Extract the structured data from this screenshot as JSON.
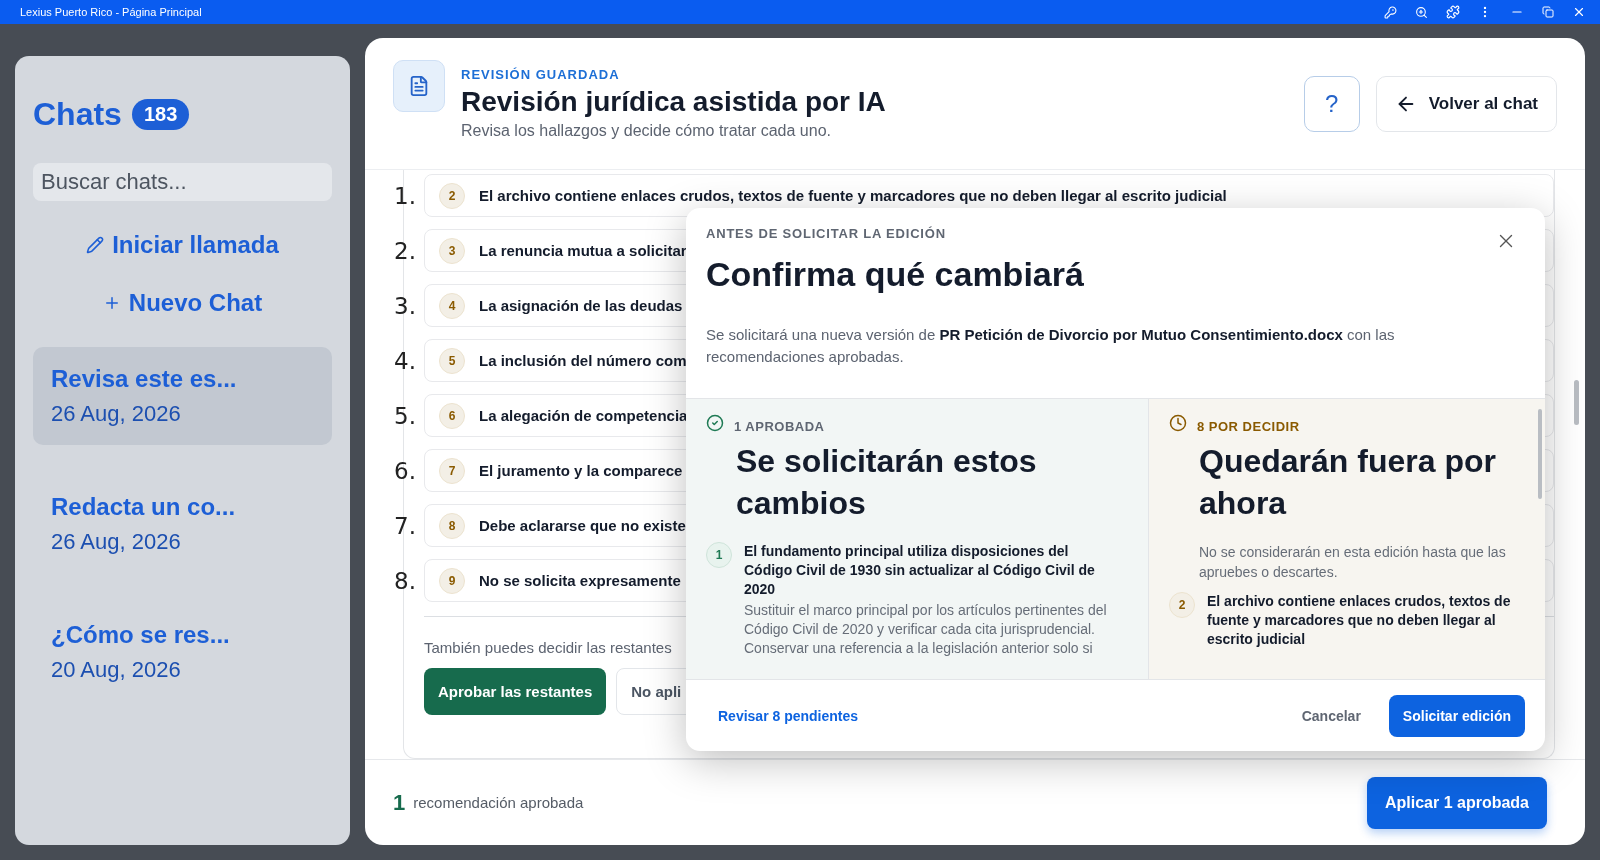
{
  "window": {
    "title": "Lexius Puerto Rico - Página Principal"
  },
  "sidebar": {
    "title": "Chats",
    "count": "183",
    "search": {
      "placeholder": "Buscar chats..."
    },
    "actions": [
      "Iniciar llamada",
      "Nuevo Chat"
    ],
    "chats": [
      {
        "title": "Revisa este es...",
        "date": "26 Aug, 2026",
        "selected": true
      },
      {
        "title": "Redacta un co...",
        "date": "26 Aug, 2026",
        "selected": false
      },
      {
        "title": "¿Cómo se res...",
        "date": "20 Aug, 2026",
        "selected": false
      }
    ]
  },
  "review": {
    "eyebrow": "REVISIÓN GUARDADA",
    "title": "Revisión jurídica asistida por IA",
    "subtitle": "Revisa los hallazgos y decide cómo tratar cada uno.",
    "help_button": "?",
    "back_button": "Volver al chat",
    "findings": [
      {
        "marker": "1.",
        "number": "2",
        "text": "El archivo contiene enlaces crudos, textos de fuente y marcadores que no deben llegar al escrito judicial"
      },
      {
        "marker": "2.",
        "number": "3",
        "text": "La renuncia mutua a solicitar"
      },
      {
        "marker": "3.",
        "number": "4",
        "text": "La asignación de las deudas"
      },
      {
        "marker": "4.",
        "number": "5",
        "text": "La inclusión del número com"
      },
      {
        "marker": "5.",
        "number": "6",
        "text": "La alegación de competencia"
      },
      {
        "marker": "6.",
        "number": "7",
        "text": "El juramento y la comparece"
      },
      {
        "marker": "7.",
        "number": "8",
        "text": "Debe aclararse que no existe"
      },
      {
        "marker": "8.",
        "number": "9",
        "text": "No se solicita expresamente"
      }
    ],
    "hint": "También puedes decidir las restantes",
    "approve_button": "Aprobar las restantes",
    "reject_button": "No apli",
    "footer": {
      "count": "1",
      "label": "recomendación aprobada",
      "apply_button": "Aplicar 1 aprobada"
    }
  },
  "dialog": {
    "eyebrow": "ANTES DE SOLICITAR LA EDICIÓN",
    "title": "Confirma qué cambiará",
    "description": "Se solicitará una nueva versión de **PR Petición de Divorcio por Mutuo Consentimiento.docx** con las recomendaciones aprobadas.",
    "columns": [
      {
        "kind": "approved",
        "label": "1 APROBADA",
        "title": "Se solicitarán estos cambios",
        "items": [
          {
            "number": "1",
            "title": "El fundamento principal utiliza disposiciones del Código Civil de 1930 sin actualizar al Código Civil de 2020",
            "detail": "Sustituir el marco principal por los artículos pertinentes del Código Civil de 2020 y verificar cada cita jurisprudencial. Conservar una referencia a la legislación anterior solo si"
          }
        ]
      },
      {
        "kind": "pending",
        "label": "8 POR DECIDIR",
        "title": "Quedarán fuera por ahora",
        "note": "No se considerarán en esta edición hasta que las apruebes o descartes.",
        "items": [
          {
            "number": "2",
            "title": "El archivo contiene enlaces crudos, textos de fuente y marcadores que no deben llegar al escrito judicial"
          }
        ]
      }
    ],
    "review_link": "Revisar 8 pendientes",
    "cancel_button": "Cancelar",
    "submit_button": "Solicitar edición"
  }
}
